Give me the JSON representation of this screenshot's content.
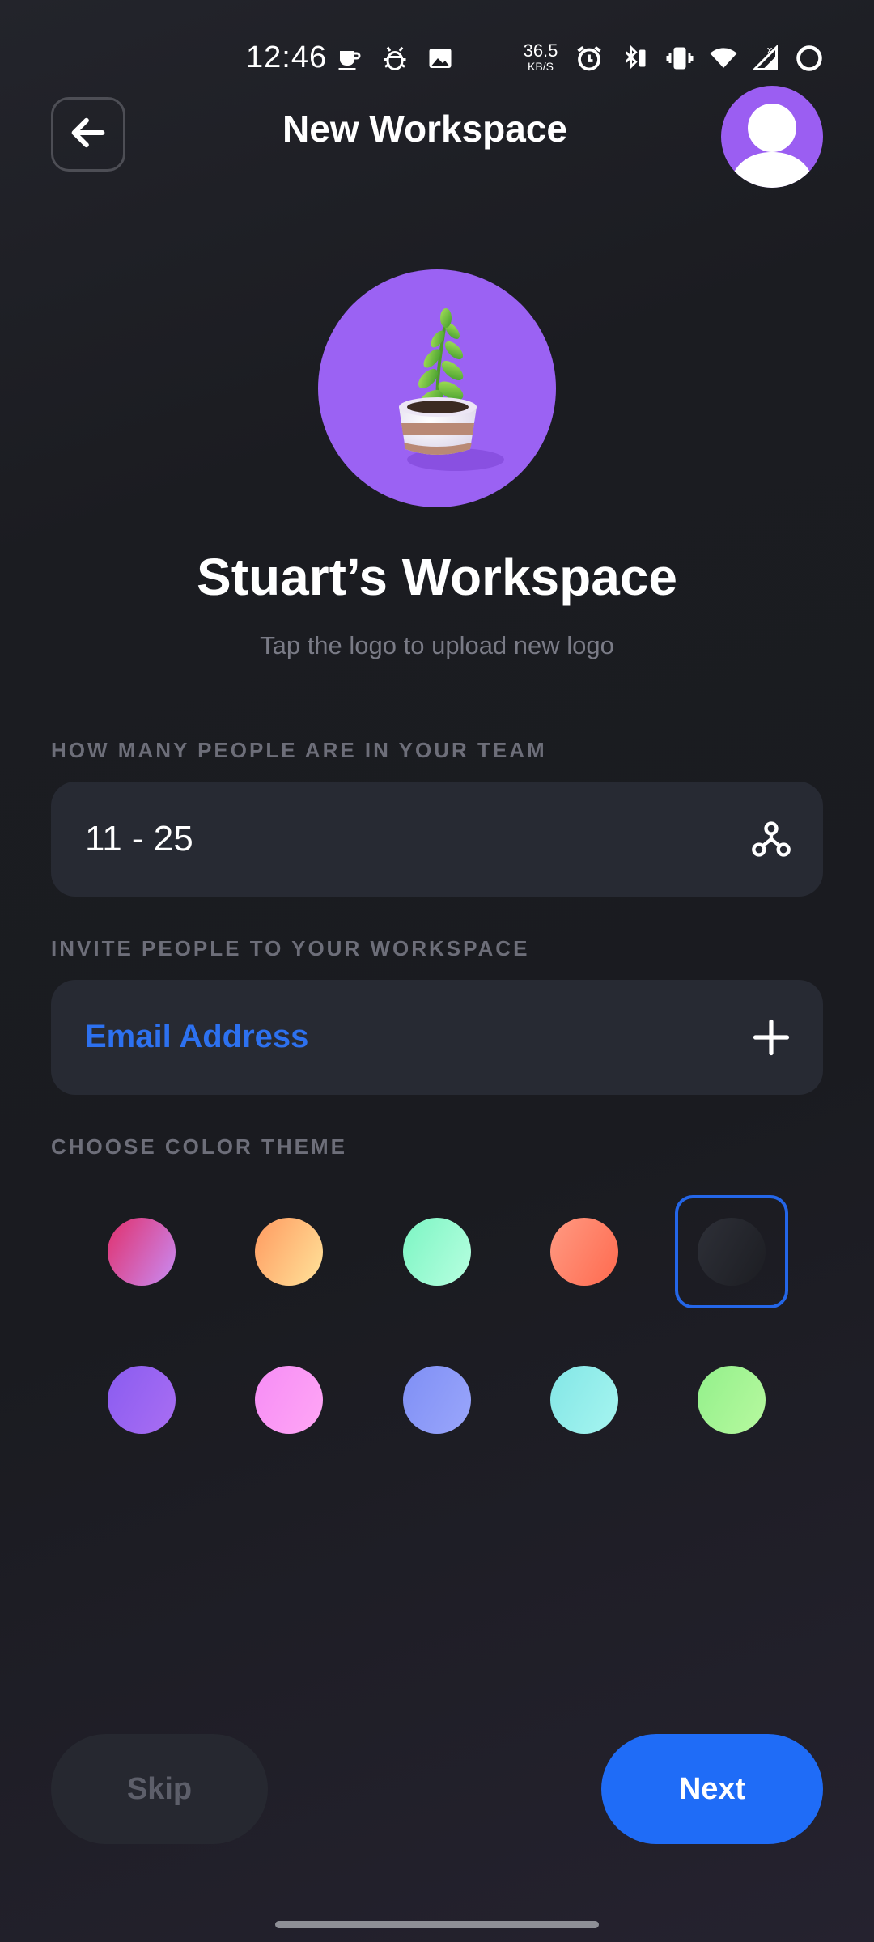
{
  "status_bar": {
    "time": "12:46",
    "net_speed_value": "36.5",
    "net_speed_unit": "KB/S",
    "icons": [
      "coffee-icon",
      "bug-icon",
      "image-icon",
      "alarm-icon",
      "bluetooth-battery-icon",
      "vibrate-icon",
      "wifi-icon",
      "signal-icon",
      "battery-ring-icon"
    ]
  },
  "header": {
    "title": "New Workspace",
    "back_icon": "arrow-left-icon",
    "avatar_icon": "user-avatar-icon"
  },
  "workspace": {
    "name": "Stuart’s Workspace",
    "logo_hint": "Tap the logo to upload new logo",
    "logo_icon": "potted-plant-icon"
  },
  "team_size": {
    "label": "HOW MANY PEOPLE ARE IN YOUR TEAM",
    "value": "11 - 25",
    "icon": "nodes-icon"
  },
  "invite": {
    "label": "INVITE PEOPLE TO YOUR WORKSPACE",
    "placeholder": "Email Address",
    "icon": "plus-icon"
  },
  "color_theme": {
    "label": "CHOOSE COLOR THEME",
    "selected_index": 4,
    "swatches": [
      {
        "name": "pink-lilac",
        "from": "#e0306c",
        "to": "#c98cf5"
      },
      {
        "name": "orange-peach",
        "from": "#ff9a60",
        "to": "#ffe39a"
      },
      {
        "name": "mint",
        "from": "#7cf5c3",
        "to": "#b7ffe0"
      },
      {
        "name": "coral",
        "from": "#ff9a82",
        "to": "#ff6a4f"
      },
      {
        "name": "charcoal",
        "from": "#2e3038",
        "to": "#1c1d22"
      },
      {
        "name": "violet",
        "from": "#8a5cf0",
        "to": "#a96ef3"
      },
      {
        "name": "pink",
        "from": "#f68df5",
        "to": "#ffa6f5"
      },
      {
        "name": "periwinkle",
        "from": "#7f8ff5",
        "to": "#9aa6fb"
      },
      {
        "name": "aqua",
        "from": "#83e6e6",
        "to": "#a6f5f0"
      },
      {
        "name": "lime",
        "from": "#93f08b",
        "to": "#b7f99f"
      }
    ]
  },
  "actions": {
    "skip_label": "Skip",
    "next_label": "Next"
  },
  "colors": {
    "accent": "#1f6cf7",
    "background": "#1a1b20",
    "field": "#272a33",
    "avatar": "#9b5ef2"
  }
}
